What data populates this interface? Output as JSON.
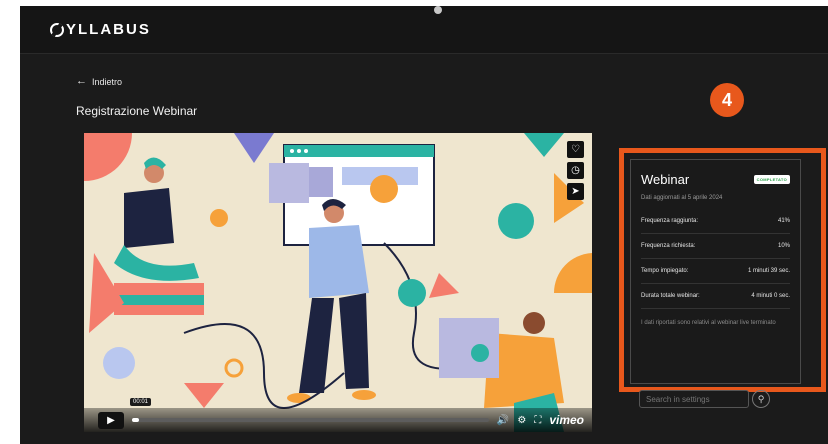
{
  "app": {
    "logo_text": "YLLABUS"
  },
  "nav": {
    "back_label": "Indietro"
  },
  "page": {
    "title": "Registrazione Webinar"
  },
  "player": {
    "timecode": "00:01",
    "progress": 0.02,
    "brand": "vimeo",
    "side_icons": [
      "heart-icon",
      "clock-icon",
      "send-icon"
    ]
  },
  "annotation": {
    "step_number": "4"
  },
  "panel": {
    "title": "Webinar",
    "status": "COMPLETATO",
    "updated": "Dati aggiornati al 5 aprile 2024",
    "stats": [
      {
        "label": "Frequenza raggiunta:",
        "value": "41%"
      },
      {
        "label": "Frequenza richiesta:",
        "value": "10%"
      },
      {
        "label": "Tempo impiegato:",
        "value": "1 minuti 39 sec."
      },
      {
        "label": "Durata totale webinar:",
        "value": "4 minuti 0 sec."
      }
    ],
    "note": "I dati riportati sono relativi al webinar live terminato"
  },
  "search": {
    "placeholder": "Search in settings"
  },
  "colors": {
    "accent": "#e8581c",
    "background": "#1b1b1b",
    "status_text": "#2aa14a"
  }
}
